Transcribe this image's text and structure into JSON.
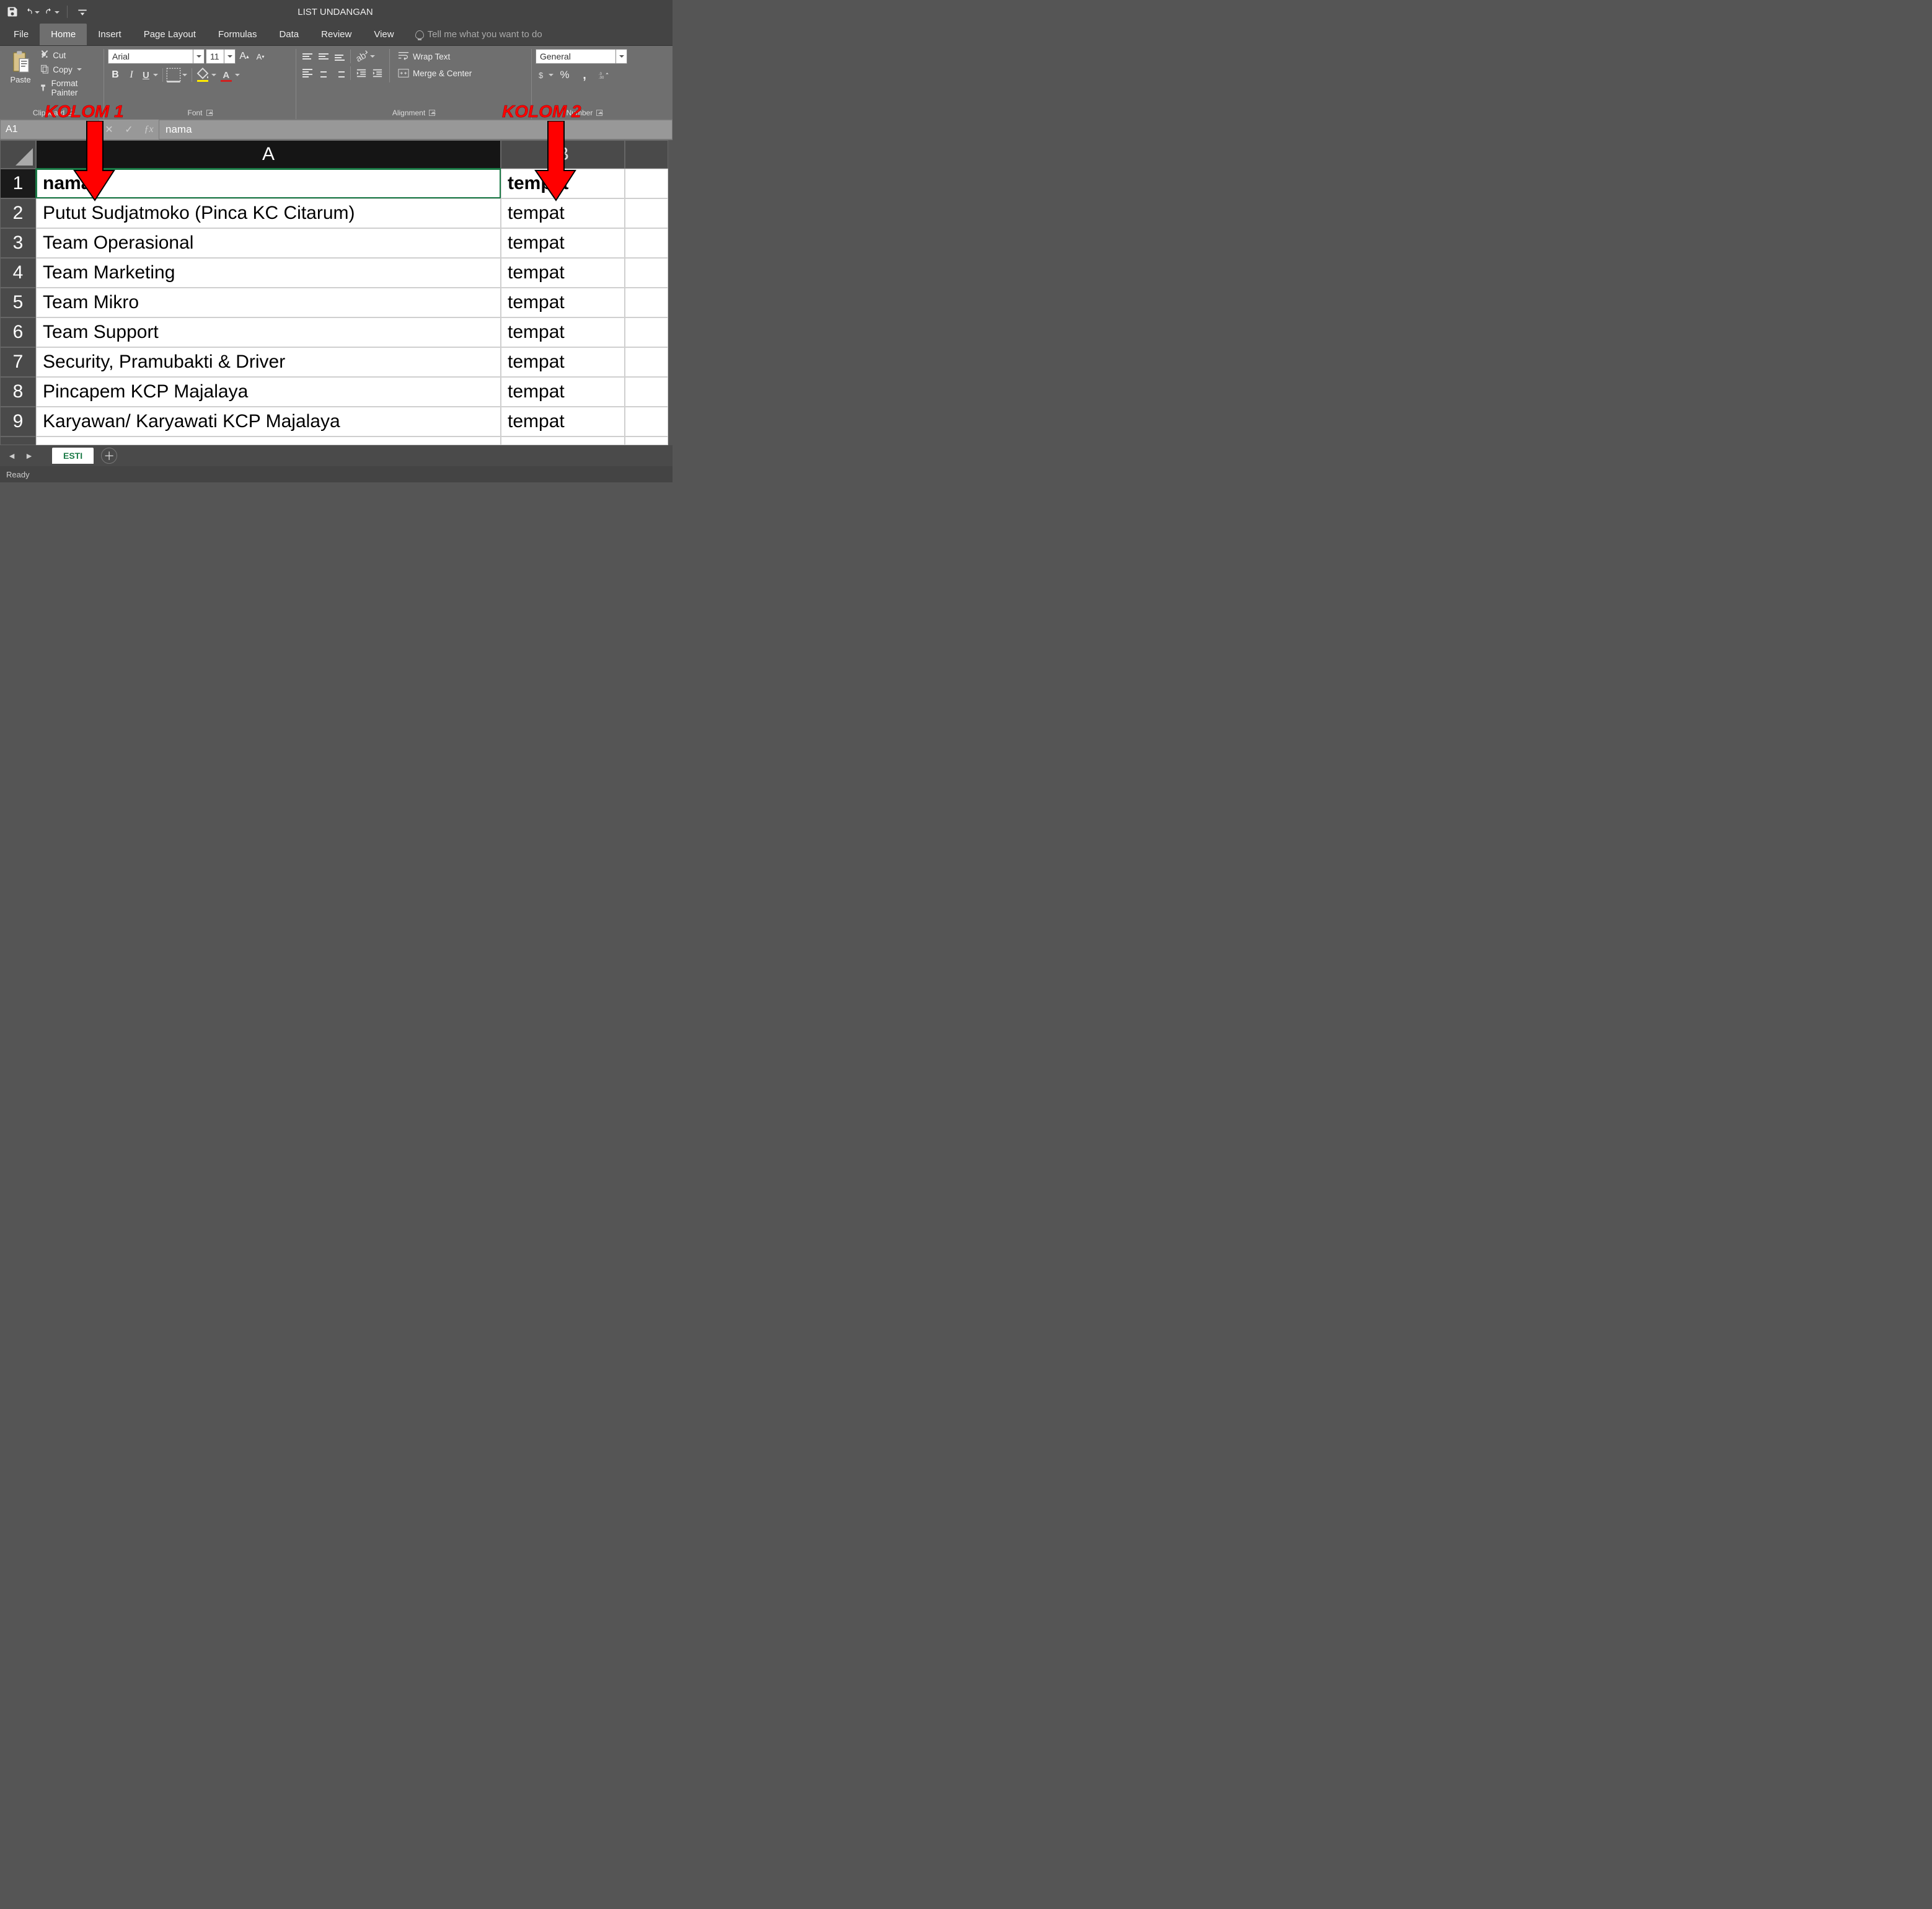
{
  "title": "LIST UNDANGAN",
  "qat": {
    "save": "save",
    "undo": "undo",
    "redo": "redo"
  },
  "tabs": {
    "file": "File",
    "home": "Home",
    "insert": "Insert",
    "page_layout": "Page Layout",
    "formulas": "Formulas",
    "data": "Data",
    "review": "Review",
    "view": "View",
    "tell_me": "Tell me what you want to do"
  },
  "ribbon": {
    "clipboard": {
      "paste": "Paste",
      "cut": "Cut",
      "copy": "Copy",
      "format_painter": "Format Painter",
      "label": "Clipboard"
    },
    "font": {
      "name": "Arial",
      "size": "11",
      "label": "Font"
    },
    "alignment": {
      "wrap": "Wrap Text",
      "merge": "Merge & Center",
      "label": "Alignment"
    },
    "number": {
      "format": "General",
      "label": "Number"
    }
  },
  "formula_bar": {
    "name_box": "A1",
    "value": "nama"
  },
  "columns": {
    "A": "A",
    "B": "B"
  },
  "rows": [
    {
      "n": "1",
      "a": "nama",
      "b": "tempat",
      "header": true
    },
    {
      "n": "2",
      "a": "Putut Sudjatmoko (Pinca KC Citarum)",
      "b": "tempat"
    },
    {
      "n": "3",
      "a": "Team Operasional",
      "b": "tempat"
    },
    {
      "n": "4",
      "a": "Team Marketing",
      "b": "tempat"
    },
    {
      "n": "5",
      "a": "Team Mikro",
      "b": "tempat"
    },
    {
      "n": "6",
      "a": "Team Support",
      "b": "tempat"
    },
    {
      "n": "7",
      "a": "Security, Pramubakti & Driver",
      "b": "tempat"
    },
    {
      "n": "8",
      "a": "Pincapem KCP Majalaya",
      "b": "tempat"
    },
    {
      "n": "9",
      "a": "Karyawan/ Karyawati KCP Majalaya",
      "b": "tempat"
    }
  ],
  "sheet_tabs": {
    "active": "ESTI"
  },
  "status": "Ready",
  "annotations": {
    "k1": "KOLOM 1",
    "k2": "KOLOM 2"
  }
}
